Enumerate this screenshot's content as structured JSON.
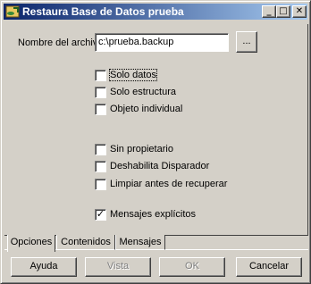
{
  "window": {
    "title": "Restaura Base de Datos prueba",
    "controls": {
      "minimize": "_",
      "maximize": "□",
      "close": "✕"
    }
  },
  "file": {
    "label": "Nombre del archivo",
    "value": "c:\\prueba.backup",
    "browse_label": "..."
  },
  "options": {
    "solo_datos": {
      "label": "Solo datos",
      "checked": false
    },
    "solo_estructura": {
      "label": "Solo estructura",
      "checked": false
    },
    "objeto_individual": {
      "label": "Objeto individual",
      "checked": false
    },
    "sin_propietario": {
      "label": "Sin propietario",
      "checked": false
    },
    "deshabilita_disparador": {
      "label": "Deshabilita Disparador",
      "checked": false
    },
    "limpiar": {
      "label": "Limpiar antes de recuperar",
      "checked": false
    },
    "mensajes_explicitos": {
      "label": "Mensajes explícitos",
      "checked": true
    }
  },
  "tabs": [
    {
      "label": "Opciones",
      "active": true
    },
    {
      "label": "Contenidos",
      "active": false
    },
    {
      "label": "Mensajes",
      "active": false
    }
  ],
  "buttons": {
    "ayuda": "Ayuda",
    "vista": "Vista",
    "ok": "OK",
    "cancelar": "Cancelar"
  },
  "check_mark": "✓"
}
